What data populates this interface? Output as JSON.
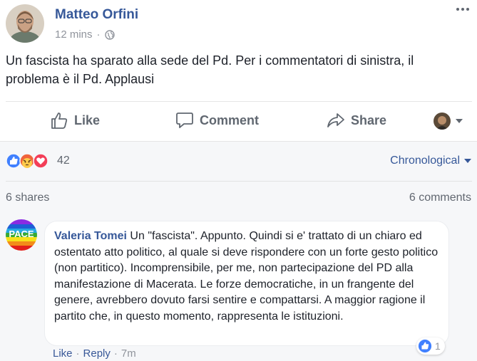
{
  "post": {
    "author": "Matteo Orfini",
    "time": "12 mins",
    "separator": "·",
    "text": "Un fascista ha sparato alla sede del Pd. Per i commentatori di sinistra, il problema è il Pd. Applausi"
  },
  "actions": {
    "like": "Like",
    "comment": "Comment",
    "share": "Share"
  },
  "reactions": {
    "count": "42",
    "types": [
      "like-icon",
      "angry-icon",
      "love-icon"
    ],
    "sort_label": "Chronological"
  },
  "stats": {
    "shares": "6 shares",
    "comments": "6 comments"
  },
  "comment": {
    "avatar_text": "PACE",
    "author": "Valeria Tomei",
    "text": " Un \"fascista\". Appunto. Quindi si e' trattato di un chiaro ed ostentato atto politico, al quale si deve rispondere con un forte gesto politico (non partitico). Incomprensibile, per me, non partecipazione del PD alla manifestazione di Macerata. Le forze democratiche, in un frangente del genere, avrebbero dovuto farsi sentire e compattarsi. A maggior ragione il partito che, in questo momento, rappresenta le istituzioni.",
    "like_label": "Like",
    "reply_label": "Reply",
    "time": "7m",
    "dot": "·",
    "likes": "1"
  },
  "colors": {
    "link": "#365899",
    "muted": "#90949c",
    "like_blue": "#4080ff",
    "angry": "#f0643c",
    "love": "#f33e58"
  }
}
